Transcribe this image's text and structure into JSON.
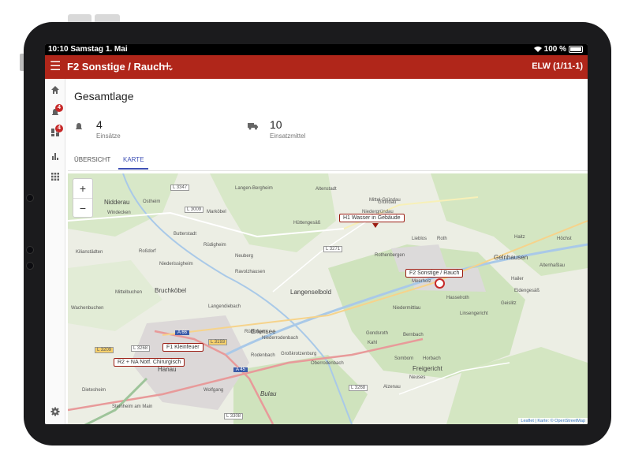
{
  "status_bar": {
    "time_date": "10:10  Samstag 1. Mai",
    "battery": "100 %"
  },
  "app_bar": {
    "title": "F2 Sonstige / Rauch",
    "vehicle": "ELW (1/11-1)"
  },
  "nav_rail": {
    "alarm_badge": "4",
    "dashboard_badge": "4"
  },
  "overview": {
    "title": "Gesamtlage",
    "stats": [
      {
        "value": "4",
        "label": "Einsätze",
        "icon": "alarm-bell-icon"
      },
      {
        "value": "10",
        "label": "Einsatzmittel",
        "icon": "truck-icon"
      }
    ],
    "tabs": [
      {
        "label": "ÜBERSICHT",
        "active": false
      },
      {
        "label": "KARTE",
        "active": true
      }
    ]
  },
  "map": {
    "zoom_in": "+",
    "zoom_out": "−",
    "markers": [
      {
        "label": "H1 Wasser in Gebäude"
      },
      {
        "label": "F2 Sonstige / Rauch"
      },
      {
        "label": "F1 Kleinfeuer"
      },
      {
        "label": "R2 + NA Notf. Chirurgisch"
      }
    ],
    "towns": [
      "Nidderau",
      "Ostheim",
      "Windecken",
      "Bruchköbel",
      "Langenselbold",
      "Erlensee",
      "Gelnhausen",
      "Hanau",
      "Freigericht",
      "Rodenbach",
      "Rückingen",
      "Langendiebach",
      "Mittelbuchen",
      "Wachenbuchen",
      "Neuberg",
      "Ravolzhausen",
      "Hüttengesäß",
      "Rothenbergen",
      "Niedermittlau",
      "Meerholz",
      "Lieblos",
      "Gründau",
      "Altenhaßlau",
      "Bernbach",
      "Somborn",
      "Alzenau",
      "Kahl",
      "Großkrotzenburg",
      "Niederrodenbach",
      "Oberrodenbach",
      "Steinheim am Main",
      "Dietesheim",
      "Wolfgang",
      "Bulau",
      "Hasselroth",
      "Gondsroth",
      "Linsengericht",
      "Neuses",
      "Horbach",
      "Niedergründau",
      "Roth",
      "Haitz",
      "Höchst",
      "Eidengesäß",
      "Geislitz",
      "Hailer",
      "Mittel-Gründau",
      "Langen-Bergheim",
      "Altenstadt",
      "Marköbel",
      "Butterstadt",
      "Kilianstädten",
      "Roßdorf",
      "Niederissigheim",
      "Rüdigheim"
    ],
    "roads": [
      "L 3347",
      "L 3009",
      "L 3271",
      "L 3209",
      "L 3268",
      "L 3193",
      "A 66",
      "A 45",
      "L 3268",
      "L 3308"
    ],
    "attribution": "Leaflet | Karte: © OpenStreetMap"
  }
}
